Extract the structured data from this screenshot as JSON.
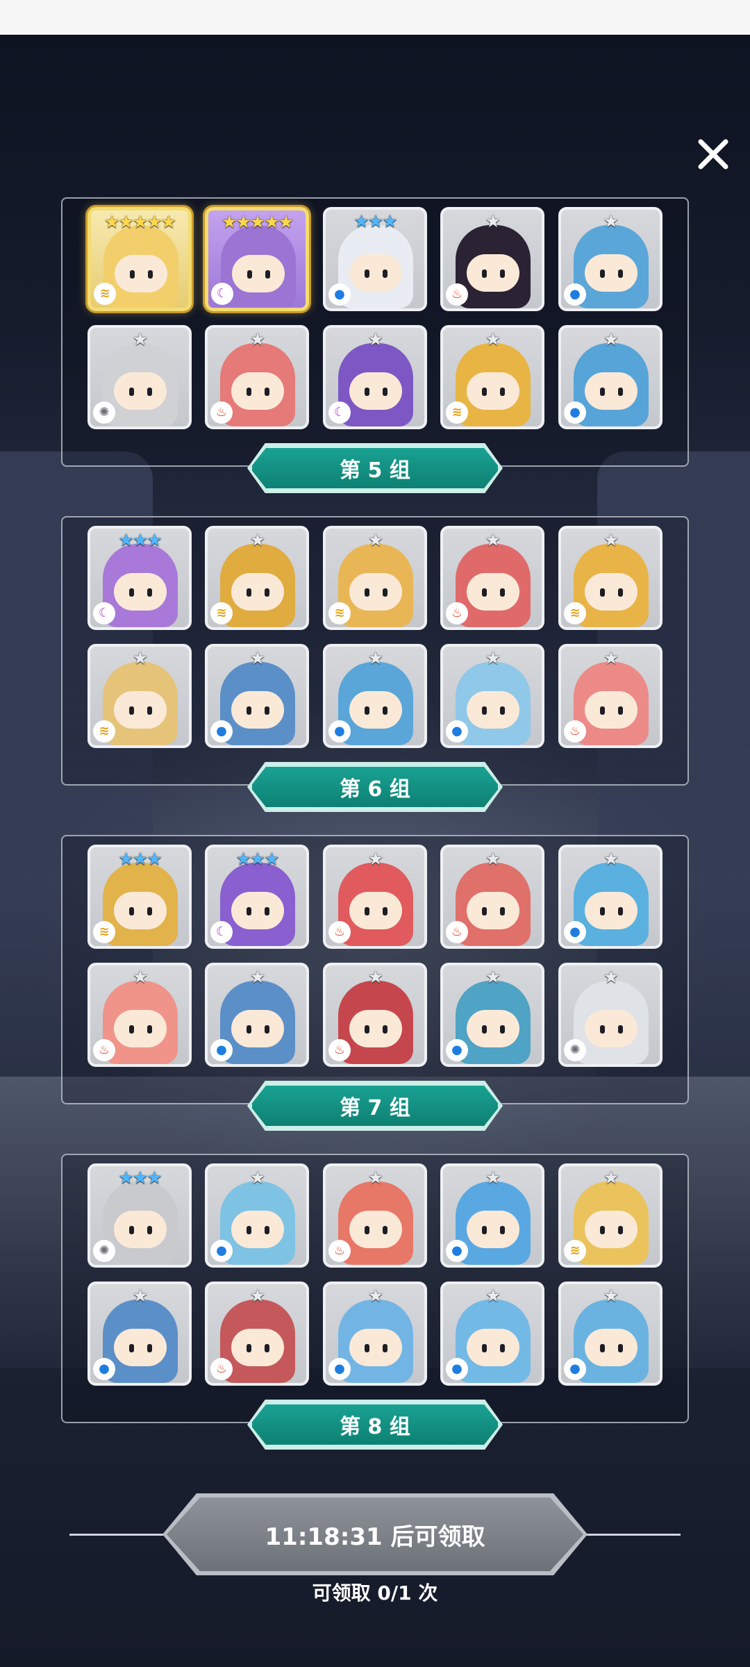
{
  "close": {
    "icon": "close-icon",
    "glyph": "✕"
  },
  "groups": [
    {
      "label": "第 5 组",
      "heroes": [
        {
          "stars": 5,
          "element": "wind",
          "color": "#f2cf6b",
          "frame": "gold"
        },
        {
          "stars": 5,
          "element": "dark",
          "color": "#9b74d4",
          "frame": "gold-purple"
        },
        {
          "stars": 3,
          "element": "water",
          "color": "#e9edf3",
          "frame": "normal"
        },
        {
          "stars": 1,
          "element": "fire",
          "color": "#2b2333",
          "frame": "normal"
        },
        {
          "stars": 1,
          "element": "water",
          "color": "#5aa6d8",
          "frame": "normal"
        },
        {
          "stars": 1,
          "element": "light",
          "color": "#cfd1d4",
          "frame": "normal"
        },
        {
          "stars": 1,
          "element": "fire",
          "color": "#e57a78",
          "frame": "normal"
        },
        {
          "stars": 1,
          "element": "dark",
          "color": "#7d58c4",
          "frame": "normal"
        },
        {
          "stars": 1,
          "element": "wind",
          "color": "#e8b545",
          "frame": "normal"
        },
        {
          "stars": 1,
          "element": "water",
          "color": "#57a4d8",
          "frame": "normal"
        }
      ]
    },
    {
      "label": "第 6 组",
      "heroes": [
        {
          "stars": 3,
          "element": "dark",
          "color": "#a879d8",
          "frame": "normal"
        },
        {
          "stars": 1,
          "element": "wind",
          "color": "#e0ab3f",
          "frame": "normal"
        },
        {
          "stars": 1,
          "element": "wind",
          "color": "#e9b656",
          "frame": "normal"
        },
        {
          "stars": 1,
          "element": "fire",
          "color": "#e06a6a",
          "frame": "normal"
        },
        {
          "stars": 1,
          "element": "wind",
          "color": "#e8b448",
          "frame": "normal"
        },
        {
          "stars": 1,
          "element": "wind",
          "color": "#e5c47a",
          "frame": "normal"
        },
        {
          "stars": 1,
          "element": "water",
          "color": "#5b8fc8",
          "frame": "normal"
        },
        {
          "stars": 1,
          "element": "water",
          "color": "#5aa6d8",
          "frame": "normal"
        },
        {
          "stars": 1,
          "element": "water",
          "color": "#8fc8e8",
          "frame": "normal"
        },
        {
          "stars": 1,
          "element": "fire",
          "color": "#ec8a88",
          "frame": "normal"
        }
      ]
    },
    {
      "label": "第 7 组",
      "heroes": [
        {
          "stars": 3,
          "element": "wind",
          "color": "#e2b24b",
          "frame": "normal"
        },
        {
          "stars": 3,
          "element": "dark",
          "color": "#8a5fd0",
          "frame": "normal"
        },
        {
          "stars": 1,
          "element": "fire",
          "color": "#e05a5e",
          "frame": "normal"
        },
        {
          "stars": 1,
          "element": "fire",
          "color": "#e0706a",
          "frame": "normal"
        },
        {
          "stars": 1,
          "element": "water",
          "color": "#5ab0df",
          "frame": "normal"
        },
        {
          "stars": 1,
          "element": "fire",
          "color": "#f0948a",
          "frame": "normal"
        },
        {
          "stars": 1,
          "element": "water",
          "color": "#5b8fc8",
          "frame": "normal"
        },
        {
          "stars": 1,
          "element": "fire",
          "color": "#c5474d",
          "frame": "normal"
        },
        {
          "stars": 1,
          "element": "water",
          "color": "#4fa3c4",
          "frame": "normal"
        },
        {
          "stars": 1,
          "element": "light",
          "color": "#dfe2e6",
          "frame": "normal"
        }
      ]
    },
    {
      "label": "第 8 组",
      "heroes": [
        {
          "stars": 3,
          "element": "light",
          "color": "#c8cacd",
          "frame": "normal"
        },
        {
          "stars": 1,
          "element": "water",
          "color": "#7ec3e4",
          "frame": "normal"
        },
        {
          "stars": 1,
          "element": "fire",
          "color": "#e77767",
          "frame": "normal"
        },
        {
          "stars": 1,
          "element": "water",
          "color": "#5aa8e2",
          "frame": "normal"
        },
        {
          "stars": 1,
          "element": "wind",
          "color": "#ebc35c",
          "frame": "normal"
        },
        {
          "stars": 1,
          "element": "water",
          "color": "#5b8fc8",
          "frame": "normal"
        },
        {
          "stars": 1,
          "element": "fire",
          "color": "#c4585a",
          "frame": "normal"
        },
        {
          "stars": 1,
          "element": "water",
          "color": "#72b5e4",
          "frame": "normal"
        },
        {
          "stars": 1,
          "element": "water",
          "color": "#73b9e6",
          "frame": "normal"
        },
        {
          "stars": 1,
          "element": "water",
          "color": "#6ab3e0",
          "frame": "normal"
        }
      ]
    }
  ],
  "element_glyphs": {
    "fire": "♨",
    "water": "●",
    "wind": "≋",
    "dark": "☾",
    "light": "✺"
  },
  "claim": {
    "button_label": "11:18:31 后可领取",
    "count_label": "可领取 0/1 次"
  }
}
